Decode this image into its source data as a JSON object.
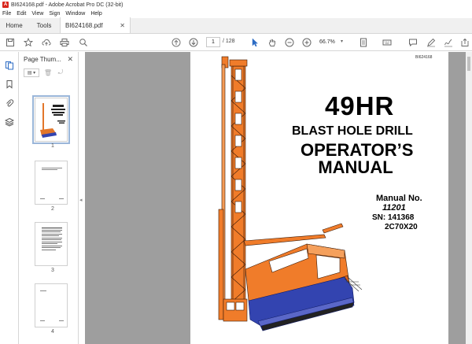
{
  "window": {
    "title": "BI624168.pdf - Adobe Acrobat Pro DC (32-bit)"
  },
  "menu": [
    "File",
    "Edit",
    "View",
    "Sign",
    "Window",
    "Help"
  ],
  "tabs": {
    "home": "Home",
    "tools": "Tools",
    "document": "BI624168.pdf"
  },
  "toolbar": {
    "current_page": "1",
    "total_pages": "/ 128",
    "zoom": "66.7%"
  },
  "panel": {
    "title": "Page Thum...",
    "thumbnails": [
      {
        "page": "1"
      },
      {
        "page": "2"
      },
      {
        "page": "3"
      },
      {
        "page": "4"
      }
    ]
  },
  "document": {
    "doc_id": "BI624168",
    "model": "49HR",
    "subtitle": "BLAST HOLE DRILL",
    "heading_line1": "OPERATOR’S",
    "heading_line2": "MANUAL",
    "manual_no_label": "Manual No.",
    "manual_no": "11201",
    "serial": "SN: 141368",
    "model_code": "2C70X20"
  },
  "colors": {
    "accent_red": "#d9261c",
    "rig_orange": "#f07c2a",
    "rig_blue": "#3344b0",
    "viewer_bg": "#9e9e9e"
  }
}
